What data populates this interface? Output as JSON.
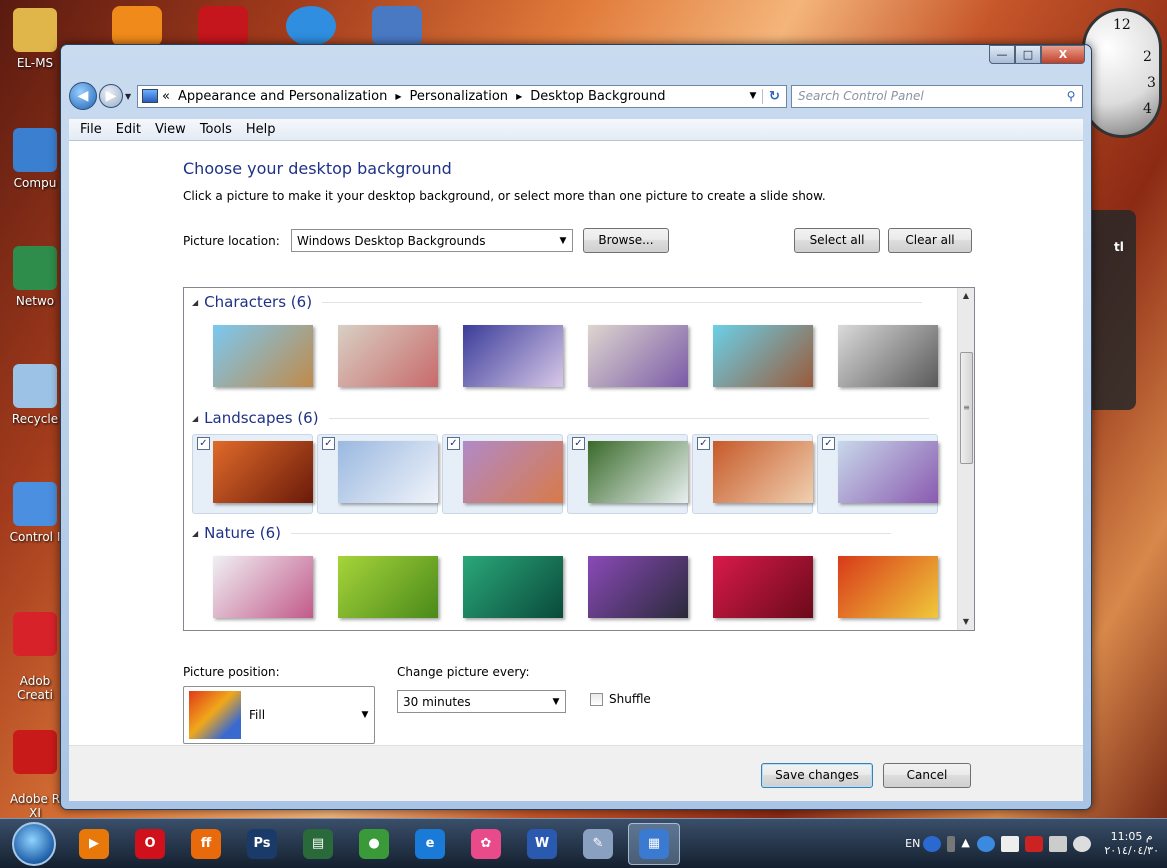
{
  "desktop": {
    "icons": [
      {
        "label": "EL-MS",
        "color": "#e0b64a"
      },
      {
        "label": "Compu",
        "color": "#3a7fd0"
      },
      {
        "label": "Netwo",
        "color": "#2e8d4a"
      },
      {
        "label": "Recycle",
        "color": "#9cc3e6"
      },
      {
        "label": "Control I",
        "color": "#4a8fe0"
      },
      {
        "label": "Adob\nCreati",
        "color": "#d8222a"
      },
      {
        "label": "Adobe R\nXI",
        "color": "#c91a1a"
      }
    ],
    "top_icons": [
      {
        "name": "avast-icon",
        "color": "#f08a1a"
      },
      {
        "name": "mcafee-icon",
        "color": "#c4161c"
      },
      {
        "name": "update-icon",
        "color": "#2f8ee0"
      },
      {
        "name": "installer-icon",
        "color": "#4a79c4"
      }
    ],
    "clock": {
      "n12": "12",
      "n3": "3",
      "n2": "2",
      "n4": "4"
    },
    "gadget": {
      "text": "tl"
    }
  },
  "window": {
    "controls": {
      "minimize": "—",
      "maximize": "□",
      "close": "X"
    },
    "address": {
      "prefix": "«",
      "segments": [
        "Appearance and Personalization",
        "Personalization",
        "Desktop Background"
      ]
    },
    "search_placeholder": "Search Control Panel",
    "menu": [
      "File",
      "Edit",
      "View",
      "Tools",
      "Help"
    ]
  },
  "page": {
    "title": "Choose your desktop background",
    "subtitle": "Click a picture to make it your desktop background, or select more than one picture to create a slide show.",
    "picture_location_label": "Picture location:",
    "picture_location_value": "Windows Desktop Backgrounds",
    "browse_label": "Browse...",
    "select_all_label": "Select all",
    "clear_all_label": "Clear all",
    "groups": [
      {
        "title": "Characters (6)",
        "checked": false,
        "images": [
          {
            "name": "characters-1",
            "colors": [
              "#7cc8f0",
              "#c08a4a"
            ]
          },
          {
            "name": "characters-2",
            "colors": [
              "#d8d0c4",
              "#c86a6a"
            ]
          },
          {
            "name": "characters-3",
            "colors": [
              "#3a3c9a",
              "#d8c8e8"
            ]
          },
          {
            "name": "characters-4",
            "colors": [
              "#ded6ce",
              "#7a5aa8"
            ]
          },
          {
            "name": "characters-5",
            "colors": [
              "#6ad0e8",
              "#9a5a3a"
            ]
          },
          {
            "name": "characters-6",
            "colors": [
              "#dadada",
              "#5a5a5a"
            ]
          }
        ]
      },
      {
        "title": "Landscapes (6)",
        "checked": true,
        "images": [
          {
            "name": "landscapes-1",
            "colors": [
              "#e06a2a",
              "#6a1a0a"
            ]
          },
          {
            "name": "landscapes-2",
            "colors": [
              "#9ab8e0",
              "#f0f4fa"
            ]
          },
          {
            "name": "landscapes-3",
            "colors": [
              "#b08ac8",
              "#d87a4a"
            ]
          },
          {
            "name": "landscapes-4",
            "colors": [
              "#3a6a2a",
              "#e8f0f0"
            ]
          },
          {
            "name": "landscapes-5",
            "colors": [
              "#c65a2a",
              "#f0d0b0"
            ]
          },
          {
            "name": "landscapes-6",
            "colors": [
              "#c8d8ea",
              "#8a5ab0"
            ]
          }
        ]
      },
      {
        "title": "Nature (6)",
        "checked": false,
        "images": [
          {
            "name": "nature-1",
            "colors": [
              "#f0f0f4",
              "#c25a8a"
            ]
          },
          {
            "name": "nature-2",
            "colors": [
              "#a6d43a",
              "#4a8a1a"
            ]
          },
          {
            "name": "nature-3",
            "colors": [
              "#2aa87a",
              "#0a4a3a"
            ]
          },
          {
            "name": "nature-4",
            "colors": [
              "#8a4ab8",
              "#2a2a3a"
            ]
          },
          {
            "name": "nature-5",
            "colors": [
              "#d81a4a",
              "#6a0a1a"
            ]
          },
          {
            "name": "nature-6",
            "colors": [
              "#d83a1a",
              "#f0c83a"
            ]
          }
        ]
      }
    ],
    "picture_position_label": "Picture position:",
    "picture_position_value": "Fill",
    "change_picture_label": "Change picture every:",
    "change_picture_value": "30 minutes",
    "shuffle_label": "Shuffle",
    "shuffle_checked": false,
    "save_label": "Save changes",
    "cancel_label": "Cancel"
  },
  "taskbar": {
    "apps": [
      {
        "name": "media-player-icon",
        "glyph": "▶",
        "color": "#e8780a"
      },
      {
        "name": "opera-icon",
        "glyph": "O",
        "color": "#d0101a"
      },
      {
        "name": "firefox-icon",
        "glyph": "ff",
        "color": "#e86a0a"
      },
      {
        "name": "photoshop-icon",
        "glyph": "Ps",
        "color": "#1a3a6a"
      },
      {
        "name": "reader-icon",
        "glyph": "▤",
        "color": "#2a6a3a"
      },
      {
        "name": "chrome-icon",
        "glyph": "●",
        "color": "#3a9a3a"
      },
      {
        "name": "internet-explorer-icon",
        "glyph": "e",
        "color": "#1a7ad8"
      },
      {
        "name": "pinwheel-icon",
        "glyph": "✿",
        "color": "#e84a8a"
      },
      {
        "name": "word-icon",
        "glyph": "W",
        "color": "#2a5ab0"
      },
      {
        "name": "paint-icon",
        "glyph": "✎",
        "color": "#8aa0c0"
      },
      {
        "name": "control-panel-icon",
        "glyph": "▦",
        "color": "#3a7ad0"
      }
    ],
    "lang": "EN",
    "time": "11:05 م",
    "date": "٢٠١٤/٠٤/٣٠"
  }
}
